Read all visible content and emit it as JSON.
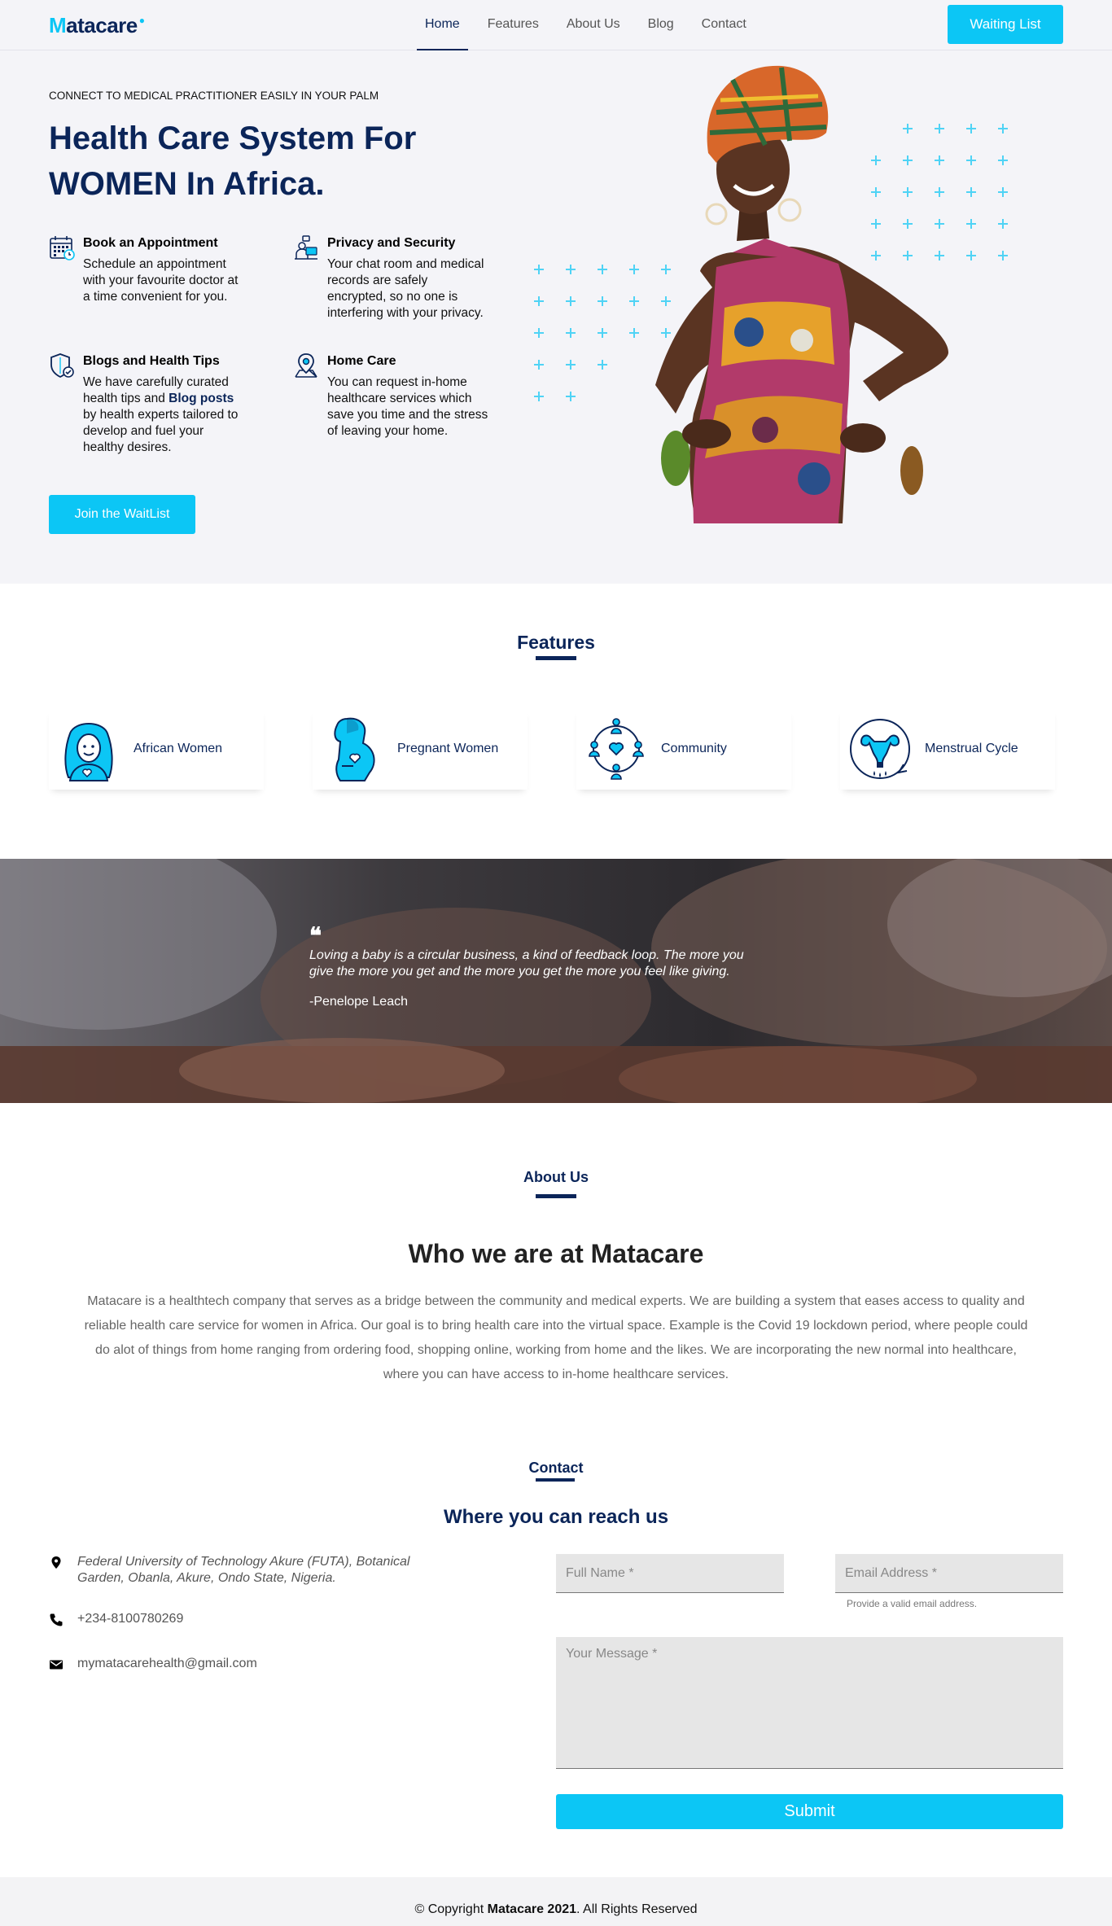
{
  "brand": {
    "logo_first": "M",
    "logo_rest": "atacare",
    "accent": "#0cc6f5",
    "navy": "#0b2559"
  },
  "nav": {
    "items": [
      {
        "label": "Home",
        "active": true
      },
      {
        "label": "Features"
      },
      {
        "label": "About Us"
      },
      {
        "label": "Blog"
      },
      {
        "label": "Contact"
      }
    ],
    "cta": "Waiting List"
  },
  "hero": {
    "eyebrow": "CONNECT TO MEDICAL PRACTITIONER EASILY IN YOUR PALM",
    "title": "Health Care System For WOMEN In Africa.",
    "features": [
      {
        "icon": "calendar-icon",
        "title": "Book an Appointment",
        "text": "Schedule an appointment with your favourite doctor at a time convenient for you."
      },
      {
        "icon": "privacy-icon",
        "title": "Privacy and Security",
        "text": "Your chat room and medical records are safely encrypted, so no one is interfering with your privacy."
      },
      {
        "icon": "shield-check-icon",
        "title": "Blogs and Health Tips",
        "text_before": "We have carefully curated health tips and ",
        "link": "Blog posts",
        "text_after": " by health experts tailored to develop and fuel your healthy desires."
      },
      {
        "icon": "location-icon",
        "title": "Home Care",
        "text": "You can request in-home healthcare services which save you time and the stress of leaving your home."
      }
    ],
    "cta": "Join the WaitList"
  },
  "features": {
    "heading": "Features",
    "cards": [
      {
        "icon": "african-woman-icon",
        "label": "African Women"
      },
      {
        "icon": "pregnant-woman-icon",
        "label": "Pregnant Women"
      },
      {
        "icon": "community-icon",
        "label": "Community"
      },
      {
        "icon": "uterus-icon",
        "label": "Menstrual Cycle"
      }
    ]
  },
  "quote": {
    "mark": "❝",
    "text": "Loving a baby is a circular business, a kind of feedback loop. The more you give the more you get and the more you get the more you feel like giving.",
    "author": "-Penelope Leach"
  },
  "about": {
    "heading": "About Us",
    "title": "Who we are at Matacare",
    "body": "Matacare is a healthtech company that serves as a bridge between the community and medical experts. We are building a system that eases access to quality and reliable health care service for women in Africa. Our goal is to bring health care into the virtual space. Example is the Covid 19 lockdown period, where people could do alot of things from home ranging from ordering food, shopping online, working from home and the likes. We are incorporating the new normal into healthcare, where you can have access to in-home healthcare services."
  },
  "contact": {
    "heading": "Contact",
    "subheading": "Where you can reach us",
    "address": "Federal University of Technology Akure (FUTA), Botanical Garden, Obanla, Akure, Ondo State, Nigeria.",
    "phone": "+234-8100780269",
    "email": "mymatacarehealth@gmail.com",
    "form": {
      "name_placeholder": "Full Name *",
      "email_placeholder": "Email Address *",
      "email_hint": "Provide a valid email address.",
      "message_placeholder": "Your Message *",
      "submit": "Submit"
    }
  },
  "footer": {
    "prefix": "© Copyright ",
    "brand": "Matacare 2021",
    "suffix": ". All Rights Reserved"
  }
}
